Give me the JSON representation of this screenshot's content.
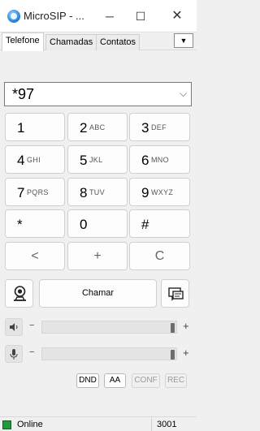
{
  "window": {
    "title": "MicroSIP - ...",
    "minimize_glyph": "─",
    "maximize_glyph": "☐",
    "close_glyph": "✕"
  },
  "tabs": [
    {
      "label": "Telefone",
      "active": true
    },
    {
      "label": "Chamadas",
      "active": false
    },
    {
      "label": "Contatos",
      "active": false
    }
  ],
  "tab_menu": {
    "glyph": "▼"
  },
  "dial": {
    "value": "*97",
    "dropdown_glyph": "⌵"
  },
  "keypad": [
    {
      "digit": "1",
      "letters": ""
    },
    {
      "digit": "2",
      "letters": "ABC"
    },
    {
      "digit": "3",
      "letters": "DEF"
    },
    {
      "digit": "4",
      "letters": "GHI"
    },
    {
      "digit": "5",
      "letters": "JKL"
    },
    {
      "digit": "6",
      "letters": "MNO"
    },
    {
      "digit": "7",
      "letters": "PQRS"
    },
    {
      "digit": "8",
      "letters": "TUV"
    },
    {
      "digit": "9",
      "letters": "WXYZ"
    },
    {
      "digit": "*",
      "letters": ""
    },
    {
      "digit": "0",
      "letters": ""
    },
    {
      "digit": "#",
      "letters": ""
    }
  ],
  "action_keys": {
    "backspace": "<",
    "plus": "+",
    "clear": "C"
  },
  "call_button": {
    "label": "Chamar"
  },
  "icons": {
    "voicemail": "voicemail-icon",
    "message": "message-icon",
    "speaker": "speaker-icon",
    "microphone": "microphone-icon"
  },
  "volume": {
    "minus": "−",
    "plus": "+",
    "speaker_level": 1.0,
    "mic_level": 1.0
  },
  "toggles": {
    "dnd": "DND",
    "aa": "AA",
    "conf": "CONF",
    "rec": "REC"
  },
  "status": {
    "text": "Online",
    "extension": "3001",
    "color": "#1e9a3a"
  }
}
